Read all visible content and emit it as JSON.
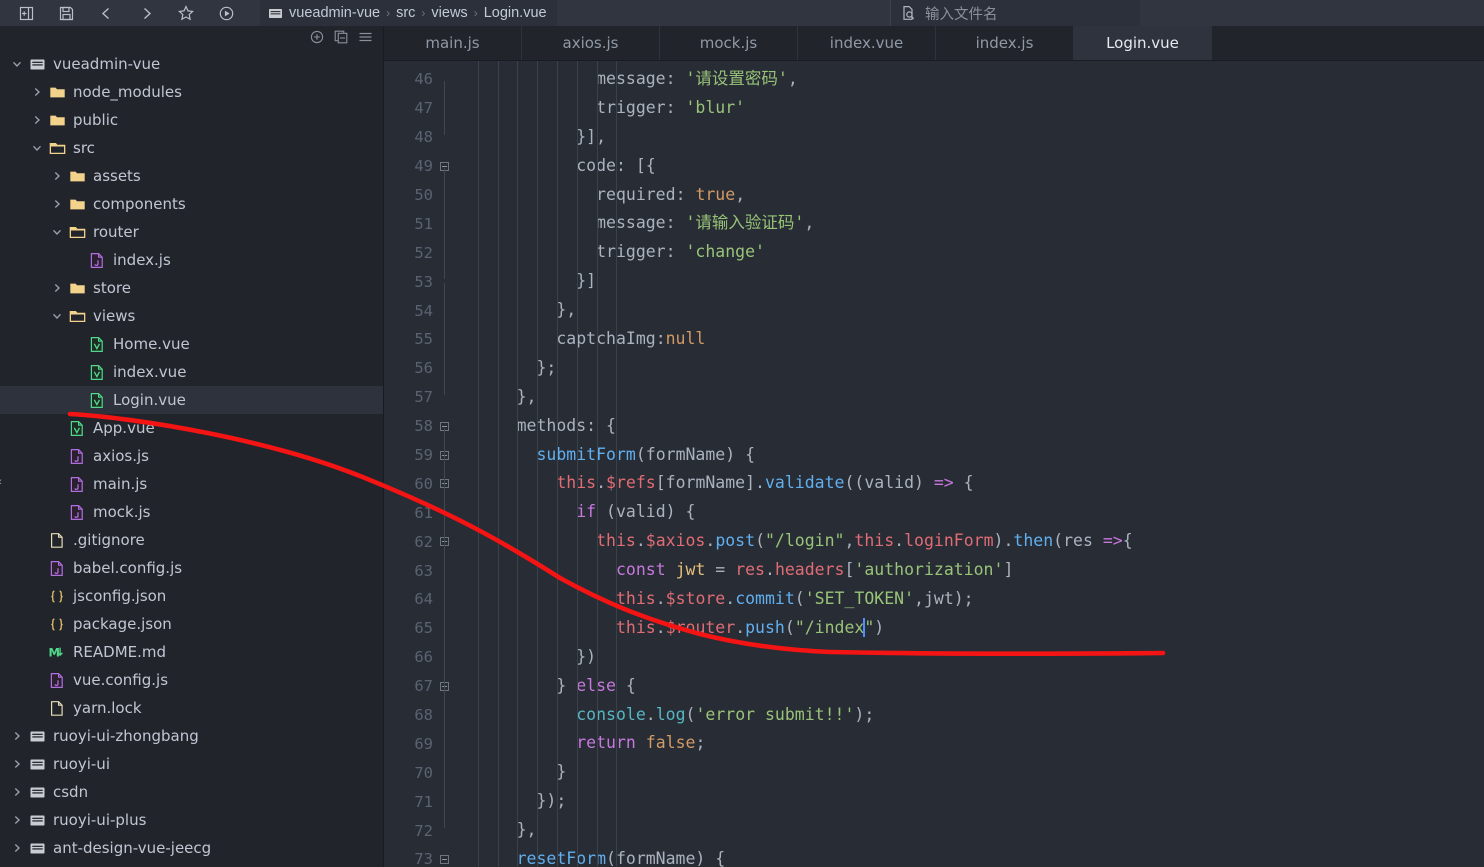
{
  "toolbar": {
    "icons": [
      {
        "name": "add-panel-icon",
        "label": "New"
      },
      {
        "name": "save-icon",
        "label": "Save All"
      },
      {
        "name": "back-chevron-icon",
        "label": "Back"
      },
      {
        "name": "forward-chevron-icon",
        "label": "Forward"
      },
      {
        "name": "star-icon",
        "label": "Bookmark"
      },
      {
        "name": "run-icon",
        "label": "Run"
      }
    ],
    "breadcrumb": [
      "vueadmin-vue",
      "src",
      "views",
      "Login.vue"
    ],
    "breadcrumb_separator": "›",
    "search_placeholder": "输入文件名"
  },
  "sidebar": {
    "actions": [
      {
        "name": "new-item-icon",
        "label": "New"
      },
      {
        "name": "collapse-all-icon",
        "label": "Collapse All"
      },
      {
        "name": "menu-icon",
        "label": "Menu"
      }
    ],
    "items": [
      {
        "label": "vueadmin-vue",
        "depth": 0,
        "chev": "down",
        "icon": "project",
        "selected": false
      },
      {
        "label": "node_modules",
        "depth": 1,
        "chev": "right",
        "icon": "folder",
        "selected": false
      },
      {
        "label": "public",
        "depth": 1,
        "chev": "right",
        "icon": "folder",
        "selected": false
      },
      {
        "label": "src",
        "depth": 1,
        "chev": "down",
        "icon": "folderopen",
        "selected": false
      },
      {
        "label": "assets",
        "depth": 2,
        "chev": "right",
        "icon": "folder",
        "selected": false
      },
      {
        "label": "components",
        "depth": 2,
        "chev": "right",
        "icon": "folder",
        "selected": false
      },
      {
        "label": "router",
        "depth": 2,
        "chev": "down",
        "icon": "folderopen",
        "selected": false
      },
      {
        "label": "index.js",
        "depth": 3,
        "chev": "none",
        "icon": "js",
        "selected": false
      },
      {
        "label": "store",
        "depth": 2,
        "chev": "right",
        "icon": "folder",
        "selected": false
      },
      {
        "label": "views",
        "depth": 2,
        "chev": "down",
        "icon": "folderopen",
        "selected": false
      },
      {
        "label": "Home.vue",
        "depth": 3,
        "chev": "none",
        "icon": "vue",
        "selected": false
      },
      {
        "label": "index.vue",
        "depth": 3,
        "chev": "none",
        "icon": "vue",
        "selected": false
      },
      {
        "label": "Login.vue",
        "depth": 3,
        "chev": "none",
        "icon": "vue",
        "selected": true
      },
      {
        "label": "App.vue",
        "depth": 2,
        "chev": "none",
        "icon": "vue",
        "selected": false
      },
      {
        "label": "axios.js",
        "depth": 2,
        "chev": "none",
        "icon": "js",
        "selected": false
      },
      {
        "label": "main.js",
        "depth": 2,
        "chev": "none",
        "icon": "js",
        "selected": false
      },
      {
        "label": "mock.js",
        "depth": 2,
        "chev": "none",
        "icon": "js",
        "selected": false
      },
      {
        "label": ".gitignore",
        "depth": 1,
        "chev": "none",
        "icon": "file",
        "selected": false
      },
      {
        "label": "babel.config.js",
        "depth": 1,
        "chev": "none",
        "icon": "js",
        "selected": false
      },
      {
        "label": "jsconfig.json",
        "depth": 1,
        "chev": "none",
        "icon": "json",
        "selected": false
      },
      {
        "label": "package.json",
        "depth": 1,
        "chev": "none",
        "icon": "json",
        "selected": false
      },
      {
        "label": "README.md",
        "depth": 1,
        "chev": "none",
        "icon": "md",
        "selected": false
      },
      {
        "label": "vue.config.js",
        "depth": 1,
        "chev": "none",
        "icon": "js",
        "selected": false
      },
      {
        "label": "yarn.lock",
        "depth": 1,
        "chev": "none",
        "icon": "file",
        "selected": false
      },
      {
        "label": "ruoyi-ui-zhongbang",
        "depth": 0,
        "chev": "right",
        "icon": "project",
        "selected": false
      },
      {
        "label": "ruoyi-ui",
        "depth": 0,
        "chev": "right",
        "icon": "project",
        "selected": false
      },
      {
        "label": "csdn",
        "depth": 0,
        "chev": "right",
        "icon": "project",
        "selected": false
      },
      {
        "label": "ruoyi-ui-plus",
        "depth": 0,
        "chev": "right",
        "icon": "project",
        "selected": false
      },
      {
        "label": "ant-design-vue-jeecg",
        "depth": 0,
        "chev": "right",
        "icon": "project",
        "selected": false
      }
    ]
  },
  "editor": {
    "tabs": [
      {
        "label": "main.js",
        "active": false
      },
      {
        "label": "axios.js",
        "active": false
      },
      {
        "label": "mock.js",
        "active": false
      },
      {
        "label": "index.vue",
        "active": false
      },
      {
        "label": "index.js",
        "active": false
      },
      {
        "label": "Login.vue",
        "active": true
      }
    ],
    "first_line": 46,
    "lines": [
      {
        "n": 46,
        "fold": false,
        "tokens": [
          {
            "t": "              ",
            "c": "t-def"
          },
          {
            "t": "message",
            "c": "t-def"
          },
          {
            "t": ": ",
            "c": "t-punc"
          },
          {
            "t": "'请设置密码'",
            "c": "t-str"
          },
          {
            "t": ",",
            "c": "t-punc"
          }
        ]
      },
      {
        "n": 47,
        "fold": false,
        "tokens": [
          {
            "t": "              ",
            "c": "t-def"
          },
          {
            "t": "trigger",
            "c": "t-def"
          },
          {
            "t": ": ",
            "c": "t-punc"
          },
          {
            "t": "'blur'",
            "c": "t-str"
          }
        ]
      },
      {
        "n": 48,
        "fold": false,
        "tokens": [
          {
            "t": "            }],",
            "c": "t-punc"
          }
        ]
      },
      {
        "n": 49,
        "fold": true,
        "tokens": [
          {
            "t": "            ",
            "c": "t-def"
          },
          {
            "t": "code",
            "c": "t-def"
          },
          {
            "t": ": [{",
            "c": "t-punc"
          }
        ]
      },
      {
        "n": 50,
        "fold": false,
        "tokens": [
          {
            "t": "              ",
            "c": "t-def"
          },
          {
            "t": "required",
            "c": "t-def"
          },
          {
            "t": ": ",
            "c": "t-punc"
          },
          {
            "t": "true",
            "c": "t-num"
          },
          {
            "t": ",",
            "c": "t-punc"
          }
        ]
      },
      {
        "n": 51,
        "fold": false,
        "tokens": [
          {
            "t": "              ",
            "c": "t-def"
          },
          {
            "t": "message",
            "c": "t-def"
          },
          {
            "t": ": ",
            "c": "t-punc"
          },
          {
            "t": "'请输入验证码'",
            "c": "t-str"
          },
          {
            "t": ",",
            "c": "t-punc"
          }
        ]
      },
      {
        "n": 52,
        "fold": false,
        "tokens": [
          {
            "t": "              ",
            "c": "t-def"
          },
          {
            "t": "trigger",
            "c": "t-def"
          },
          {
            "t": ": ",
            "c": "t-punc"
          },
          {
            "t": "'change'",
            "c": "t-str"
          }
        ]
      },
      {
        "n": 53,
        "fold": false,
        "tokens": [
          {
            "t": "            }]",
            "c": "t-punc"
          }
        ]
      },
      {
        "n": 54,
        "fold": false,
        "tokens": [
          {
            "t": "          },",
            "c": "t-punc"
          }
        ]
      },
      {
        "n": 55,
        "fold": false,
        "tokens": [
          {
            "t": "          ",
            "c": "t-def"
          },
          {
            "t": "captchaImg",
            "c": "t-def"
          },
          {
            "t": ":",
            "c": "t-punc"
          },
          {
            "t": "null",
            "c": "t-num"
          }
        ]
      },
      {
        "n": 56,
        "fold": false,
        "tokens": [
          {
            "t": "        };",
            "c": "t-punc"
          }
        ]
      },
      {
        "n": 57,
        "fold": false,
        "tokens": [
          {
            "t": "      },",
            "c": "t-punc"
          }
        ]
      },
      {
        "n": 58,
        "fold": true,
        "tokens": [
          {
            "t": "      ",
            "c": "t-def"
          },
          {
            "t": "methods",
            "c": "t-def"
          },
          {
            "t": ": {",
            "c": "t-punc"
          }
        ]
      },
      {
        "n": 59,
        "fold": true,
        "tokens": [
          {
            "t": "        ",
            "c": "t-def"
          },
          {
            "t": "submitForm",
            "c": "t-fn"
          },
          {
            "t": "(formName) {",
            "c": "t-punc"
          }
        ]
      },
      {
        "n": 60,
        "fold": true,
        "tokens": [
          {
            "t": "          ",
            "c": "t-def"
          },
          {
            "t": "this",
            "c": "t-this"
          },
          {
            "t": ".",
            "c": "t-punc"
          },
          {
            "t": "$refs",
            "c": "t-this"
          },
          {
            "t": "[formName].",
            "c": "t-punc"
          },
          {
            "t": "validate",
            "c": "t-fn"
          },
          {
            "t": "((valid) ",
            "c": "t-punc"
          },
          {
            "t": "=>",
            "c": "t-key"
          },
          {
            "t": " {",
            "c": "t-punc"
          }
        ]
      },
      {
        "n": 61,
        "fold": false,
        "tokens": [
          {
            "t": "            ",
            "c": "t-def"
          },
          {
            "t": "if",
            "c": "t-key"
          },
          {
            "t": " (valid) {",
            "c": "t-punc"
          }
        ]
      },
      {
        "n": 62,
        "fold": true,
        "tokens": [
          {
            "t": "              ",
            "c": "t-def"
          },
          {
            "t": "this",
            "c": "t-this"
          },
          {
            "t": ".",
            "c": "t-punc"
          },
          {
            "t": "$axios",
            "c": "t-this"
          },
          {
            "t": ".",
            "c": "t-punc"
          },
          {
            "t": "post",
            "c": "t-fn"
          },
          {
            "t": "(",
            "c": "t-punc"
          },
          {
            "t": "\"/login\"",
            "c": "t-str"
          },
          {
            "t": ",",
            "c": "t-punc"
          },
          {
            "t": "this",
            "c": "t-this"
          },
          {
            "t": ".",
            "c": "t-punc"
          },
          {
            "t": "loginForm",
            "c": "t-this"
          },
          {
            "t": ").",
            "c": "t-punc"
          },
          {
            "t": "then",
            "c": "t-fn"
          },
          {
            "t": "(res ",
            "c": "t-punc"
          },
          {
            "t": "=>",
            "c": "t-key"
          },
          {
            "t": "{",
            "c": "t-punc"
          }
        ]
      },
      {
        "n": 63,
        "fold": false,
        "tokens": [
          {
            "t": "                ",
            "c": "t-def"
          },
          {
            "t": "const",
            "c": "t-key"
          },
          {
            "t": " ",
            "c": "t-punc"
          },
          {
            "t": "jwt",
            "c": "t-prop"
          },
          {
            "t": " = ",
            "c": "t-punc"
          },
          {
            "t": "res",
            "c": "t-this"
          },
          {
            "t": ".",
            "c": "t-punc"
          },
          {
            "t": "headers",
            "c": "t-this"
          },
          {
            "t": "[",
            "c": "t-punc"
          },
          {
            "t": "'authorization'",
            "c": "t-str"
          },
          {
            "t": "]",
            "c": "t-punc"
          }
        ]
      },
      {
        "n": 64,
        "fold": false,
        "tokens": [
          {
            "t": "                ",
            "c": "t-def"
          },
          {
            "t": "this",
            "c": "t-this"
          },
          {
            "t": ".",
            "c": "t-punc"
          },
          {
            "t": "$store",
            "c": "t-this"
          },
          {
            "t": ".",
            "c": "t-punc"
          },
          {
            "t": "commit",
            "c": "t-fn"
          },
          {
            "t": "(",
            "c": "t-punc"
          },
          {
            "t": "'SET_TOKEN'",
            "c": "t-str"
          },
          {
            "t": ",jwt);",
            "c": "t-punc"
          }
        ]
      },
      {
        "n": 65,
        "fold": false,
        "cursor_after": "\"/index",
        "tokens": [
          {
            "t": "                ",
            "c": "t-def"
          },
          {
            "t": "this",
            "c": "t-this"
          },
          {
            "t": ".",
            "c": "t-punc"
          },
          {
            "t": "$router",
            "c": "t-this"
          },
          {
            "t": ".",
            "c": "t-punc"
          },
          {
            "t": "push",
            "c": "t-fn"
          },
          {
            "t": "(",
            "c": "t-punc"
          },
          {
            "t": "\"/index",
            "c": "t-str"
          },
          {
            "t": "CURSOR",
            "c": "cursor"
          },
          {
            "t": "\"",
            "c": "t-str"
          },
          {
            "t": ")",
            "c": "t-punc"
          }
        ]
      },
      {
        "n": 66,
        "fold": false,
        "tokens": [
          {
            "t": "            })",
            "c": "t-punc"
          }
        ]
      },
      {
        "n": 67,
        "fold": true,
        "tokens": [
          {
            "t": "          } ",
            "c": "t-punc"
          },
          {
            "t": "else",
            "c": "t-key"
          },
          {
            "t": " {",
            "c": "t-punc"
          }
        ]
      },
      {
        "n": 68,
        "fold": false,
        "tokens": [
          {
            "t": "            ",
            "c": "t-def"
          },
          {
            "t": "console",
            "c": "t-cyan"
          },
          {
            "t": ".",
            "c": "t-punc"
          },
          {
            "t": "log",
            "c": "t-cyan"
          },
          {
            "t": "(",
            "c": "t-punc"
          },
          {
            "t": "'error submit!!'",
            "c": "t-str"
          },
          {
            "t": ");",
            "c": "t-punc"
          }
        ]
      },
      {
        "n": 69,
        "fold": false,
        "tokens": [
          {
            "t": "            ",
            "c": "t-def"
          },
          {
            "t": "return",
            "c": "t-key"
          },
          {
            "t": " ",
            "c": "t-punc"
          },
          {
            "t": "false",
            "c": "t-num"
          },
          {
            "t": ";",
            "c": "t-punc"
          }
        ]
      },
      {
        "n": 70,
        "fold": false,
        "tokens": [
          {
            "t": "          }",
            "c": "t-punc"
          }
        ]
      },
      {
        "n": 71,
        "fold": false,
        "tokens": [
          {
            "t": "        });",
            "c": "t-punc"
          }
        ]
      },
      {
        "n": 72,
        "fold": false,
        "tokens": [
          {
            "t": "      },",
            "c": "t-punc"
          }
        ]
      },
      {
        "n": 73,
        "fold": true,
        "tokens": [
          {
            "t": "      ",
            "c": "t-def"
          },
          {
            "t": "resetForm",
            "c": "t-fn"
          },
          {
            "t": "(formName) {",
            "c": "t-punc"
          }
        ]
      }
    ],
    "collapse_handle": "‹"
  },
  "colors": {
    "bg_editor": "#282c34",
    "bg_sidebar": "#21252b",
    "bg_toolbar": "#30353f",
    "accent_selected": "#2d323c",
    "annotation_red": "#f41414",
    "cursor_blue": "#528bff",
    "string_green": "#98c379",
    "keyword_purple": "#c678dd",
    "function_blue": "#61afef",
    "variable_red": "#e06c75",
    "number_orange": "#d19a66"
  }
}
